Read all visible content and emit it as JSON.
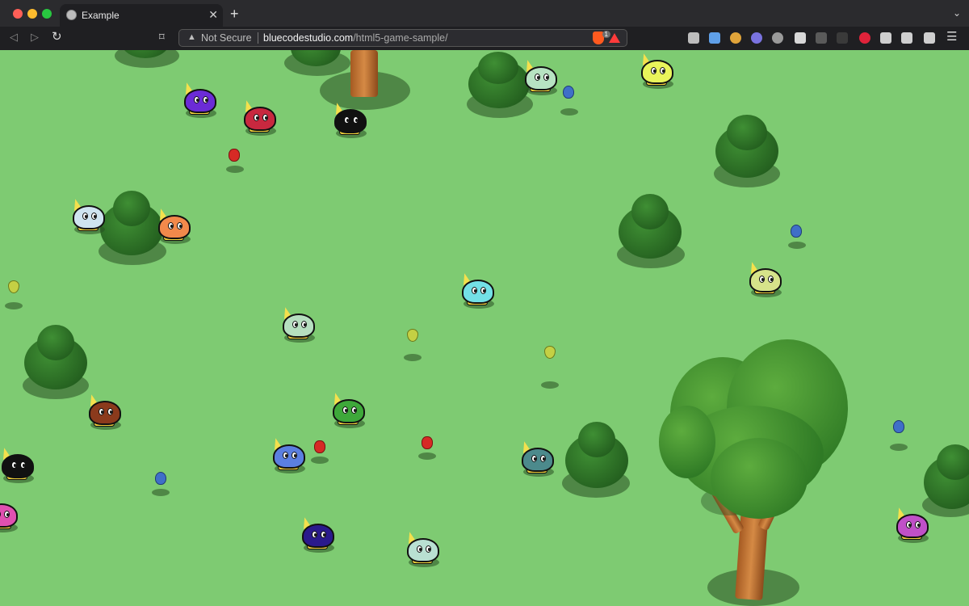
{
  "window": {
    "traffic_lights": {
      "close": "#ff5f57",
      "minimize": "#febc2e",
      "maximize": "#28c840"
    }
  },
  "tab": {
    "title": "Example",
    "icon": "globe-icon"
  },
  "toolbar": {
    "security_label": "Not Secure",
    "url_host": "bluecodestudio.com",
    "url_path": "/html5-game-sample/",
    "brave_badge": "1"
  },
  "game": {
    "background": "#7ecb72",
    "creature_colors": [
      "#6b2bd6",
      "#c8283f",
      "#111111",
      "#b7e3c2",
      "#e9f55b",
      "#cfe4f0",
      "#f2894b",
      "#73e0e6",
      "#d6e38a",
      "#b6dfc0",
      "#8b3a1c",
      "#3ea83a",
      "#5b7fe0",
      "#4c8a8c",
      "#2a1a8c",
      "#b9e0d2",
      "#c050c8",
      "#111111",
      "#e050b0"
    ],
    "fruit_types": [
      "apple",
      "pear",
      "plum"
    ]
  }
}
